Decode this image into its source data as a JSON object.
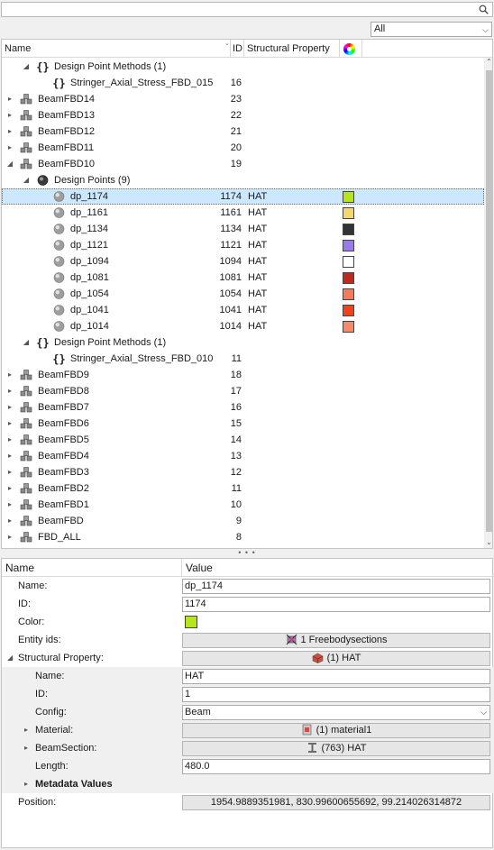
{
  "filter": {
    "selected": "All"
  },
  "tree": {
    "columns": {
      "name": "Name",
      "id": "ID",
      "structural_property": "Structural Property"
    },
    "rows": [
      {
        "name": "Design Point Methods (1)",
        "id": "",
        "sp": "",
        "icon": "braces-icon",
        "indent": 1,
        "expander": "expanded",
        "color": ""
      },
      {
        "name": "Stringer_Axial_Stress_FBD_015",
        "id": "16",
        "sp": "",
        "icon": "braces-icon",
        "indent": 2,
        "expander": "none",
        "color": ""
      },
      {
        "name": "BeamFBD14",
        "id": "23",
        "sp": "",
        "icon": "fbd-icon",
        "indent": 0,
        "expander": "collapsed",
        "color": ""
      },
      {
        "name": "BeamFBD13",
        "id": "22",
        "sp": "",
        "icon": "fbd-icon",
        "indent": 0,
        "expander": "collapsed",
        "color": ""
      },
      {
        "name": "BeamFBD12",
        "id": "21",
        "sp": "",
        "icon": "fbd-icon",
        "indent": 0,
        "expander": "collapsed",
        "color": ""
      },
      {
        "name": "BeamFBD11",
        "id": "20",
        "sp": "",
        "icon": "fbd-icon",
        "indent": 0,
        "expander": "collapsed",
        "color": ""
      },
      {
        "name": "BeamFBD10",
        "id": "19",
        "sp": "",
        "icon": "fbd-icon",
        "indent": 0,
        "expander": "expanded",
        "color": ""
      },
      {
        "name": "Design Points (9)",
        "id": "",
        "sp": "",
        "icon": "design-points-icon",
        "indent": 1,
        "expander": "expanded",
        "color": ""
      },
      {
        "name": "dp_1174",
        "id": "1174",
        "sp": "HAT",
        "icon": "sphere-icon",
        "indent": 2,
        "expander": "none",
        "color": "#b5e61d",
        "selected": true
      },
      {
        "name": "dp_1161",
        "id": "1161",
        "sp": "HAT",
        "icon": "sphere-icon",
        "indent": 2,
        "expander": "none",
        "color": "#f5d76e"
      },
      {
        "name": "dp_1134",
        "id": "1134",
        "sp": "HAT",
        "icon": "sphere-icon",
        "indent": 2,
        "expander": "none",
        "color": "#333333"
      },
      {
        "name": "dp_1121",
        "id": "1121",
        "sp": "HAT",
        "icon": "sphere-icon",
        "indent": 2,
        "expander": "none",
        "color": "#9b7bea"
      },
      {
        "name": "dp_1094",
        "id": "1094",
        "sp": "HAT",
        "icon": "sphere-icon",
        "indent": 2,
        "expander": "none",
        "color": "#ffffff"
      },
      {
        "name": "dp_1081",
        "id": "1081",
        "sp": "HAT",
        "icon": "sphere-icon",
        "indent": 2,
        "expander": "none",
        "color": "#c0281e"
      },
      {
        "name": "dp_1054",
        "id": "1054",
        "sp": "HAT",
        "icon": "sphere-icon",
        "indent": 2,
        "expander": "none",
        "color": "#f47c5a"
      },
      {
        "name": "dp_1041",
        "id": "1041",
        "sp": "HAT",
        "icon": "sphere-icon",
        "indent": 2,
        "expander": "none",
        "color": "#f0421e"
      },
      {
        "name": "dp_1014",
        "id": "1014",
        "sp": "HAT",
        "icon": "sphere-icon",
        "indent": 2,
        "expander": "none",
        "color": "#f58a6a"
      },
      {
        "name": "Design Point Methods (1)",
        "id": "",
        "sp": "",
        "icon": "braces-icon",
        "indent": 1,
        "expander": "expanded",
        "color": ""
      },
      {
        "name": "Stringer_Axial_Stress_FBD_010",
        "id": "11",
        "sp": "",
        "icon": "braces-icon",
        "indent": 2,
        "expander": "none",
        "color": ""
      },
      {
        "name": "BeamFBD9",
        "id": "18",
        "sp": "",
        "icon": "fbd-icon",
        "indent": 0,
        "expander": "collapsed",
        "color": ""
      },
      {
        "name": "BeamFBD8",
        "id": "17",
        "sp": "",
        "icon": "fbd-icon",
        "indent": 0,
        "expander": "collapsed",
        "color": ""
      },
      {
        "name": "BeamFBD7",
        "id": "16",
        "sp": "",
        "icon": "fbd-icon",
        "indent": 0,
        "expander": "collapsed",
        "color": ""
      },
      {
        "name": "BeamFBD6",
        "id": "15",
        "sp": "",
        "icon": "fbd-icon",
        "indent": 0,
        "expander": "collapsed",
        "color": ""
      },
      {
        "name": "BeamFBD5",
        "id": "14",
        "sp": "",
        "icon": "fbd-icon",
        "indent": 0,
        "expander": "collapsed",
        "color": ""
      },
      {
        "name": "BeamFBD4",
        "id": "13",
        "sp": "",
        "icon": "fbd-icon",
        "indent": 0,
        "expander": "collapsed",
        "color": ""
      },
      {
        "name": "BeamFBD3",
        "id": "12",
        "sp": "",
        "icon": "fbd-icon",
        "indent": 0,
        "expander": "collapsed",
        "color": ""
      },
      {
        "name": "BeamFBD2",
        "id": "11",
        "sp": "",
        "icon": "fbd-icon",
        "indent": 0,
        "expander": "collapsed",
        "color": ""
      },
      {
        "name": "BeamFBD1",
        "id": "10",
        "sp": "",
        "icon": "fbd-icon",
        "indent": 0,
        "expander": "collapsed",
        "color": ""
      },
      {
        "name": "BeamFBD",
        "id": "9",
        "sp": "",
        "icon": "fbd-icon",
        "indent": 0,
        "expander": "collapsed",
        "color": ""
      },
      {
        "name": "FBD_ALL",
        "id": "8",
        "sp": "",
        "icon": "fbd-icon",
        "indent": 0,
        "expander": "collapsed",
        "color": ""
      }
    ]
  },
  "props": {
    "columns": {
      "name": "Name",
      "value": "Value"
    },
    "name_label": "Name:",
    "name_value": "dp_1174",
    "id_label": "ID:",
    "id_value": "1174",
    "color_label": "Color:",
    "color_value": "#b5e61d",
    "entity_ids_label": "Entity ids:",
    "entity_ids_value": "1 Freebodysections",
    "structural_property_label": "Structural Property:",
    "structural_property_value": "(1) HAT",
    "sp_name_label": "Name:",
    "sp_name_value": "HAT",
    "sp_id_label": "ID:",
    "sp_id_value": "1",
    "sp_config_label": "Config:",
    "sp_config_value": "Beam",
    "sp_material_label": "Material:",
    "sp_material_value": "(1) material1",
    "sp_beamsection_label": "BeamSection:",
    "sp_beamsection_value": "(763) HAT",
    "sp_length_label": "Length:",
    "sp_length_value": "480.0",
    "metadata_label": "Metadata Values",
    "position_label": "Position:",
    "position_value": "1954.9889351981, 830.99600655692, 99.214026314872"
  }
}
